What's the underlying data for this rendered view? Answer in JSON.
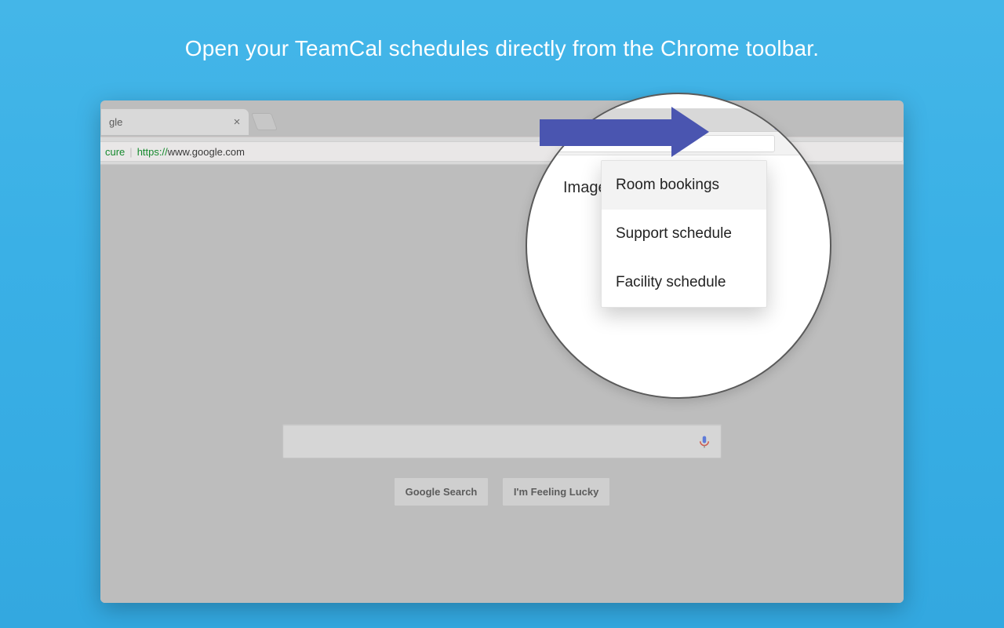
{
  "headline": "Open your TeamCal schedules directly from the Chrome toolbar.",
  "tab": {
    "title_fragment": "gle"
  },
  "url": {
    "secure_label": "cure",
    "scheme": "https://",
    "rest": "www.google.com"
  },
  "toolbar_right": {
    "images_label_fragment": "Image"
  },
  "search": {
    "btn_search": "Google Search",
    "btn_lucky": "I'm Feeling Lucky"
  },
  "menu": {
    "items": [
      "Room bookings",
      "Support schedule",
      "Facility schedule"
    ],
    "hover_index": 0
  },
  "colors": {
    "accent": "#4a55b0",
    "ext_icon": "#5865d6"
  }
}
